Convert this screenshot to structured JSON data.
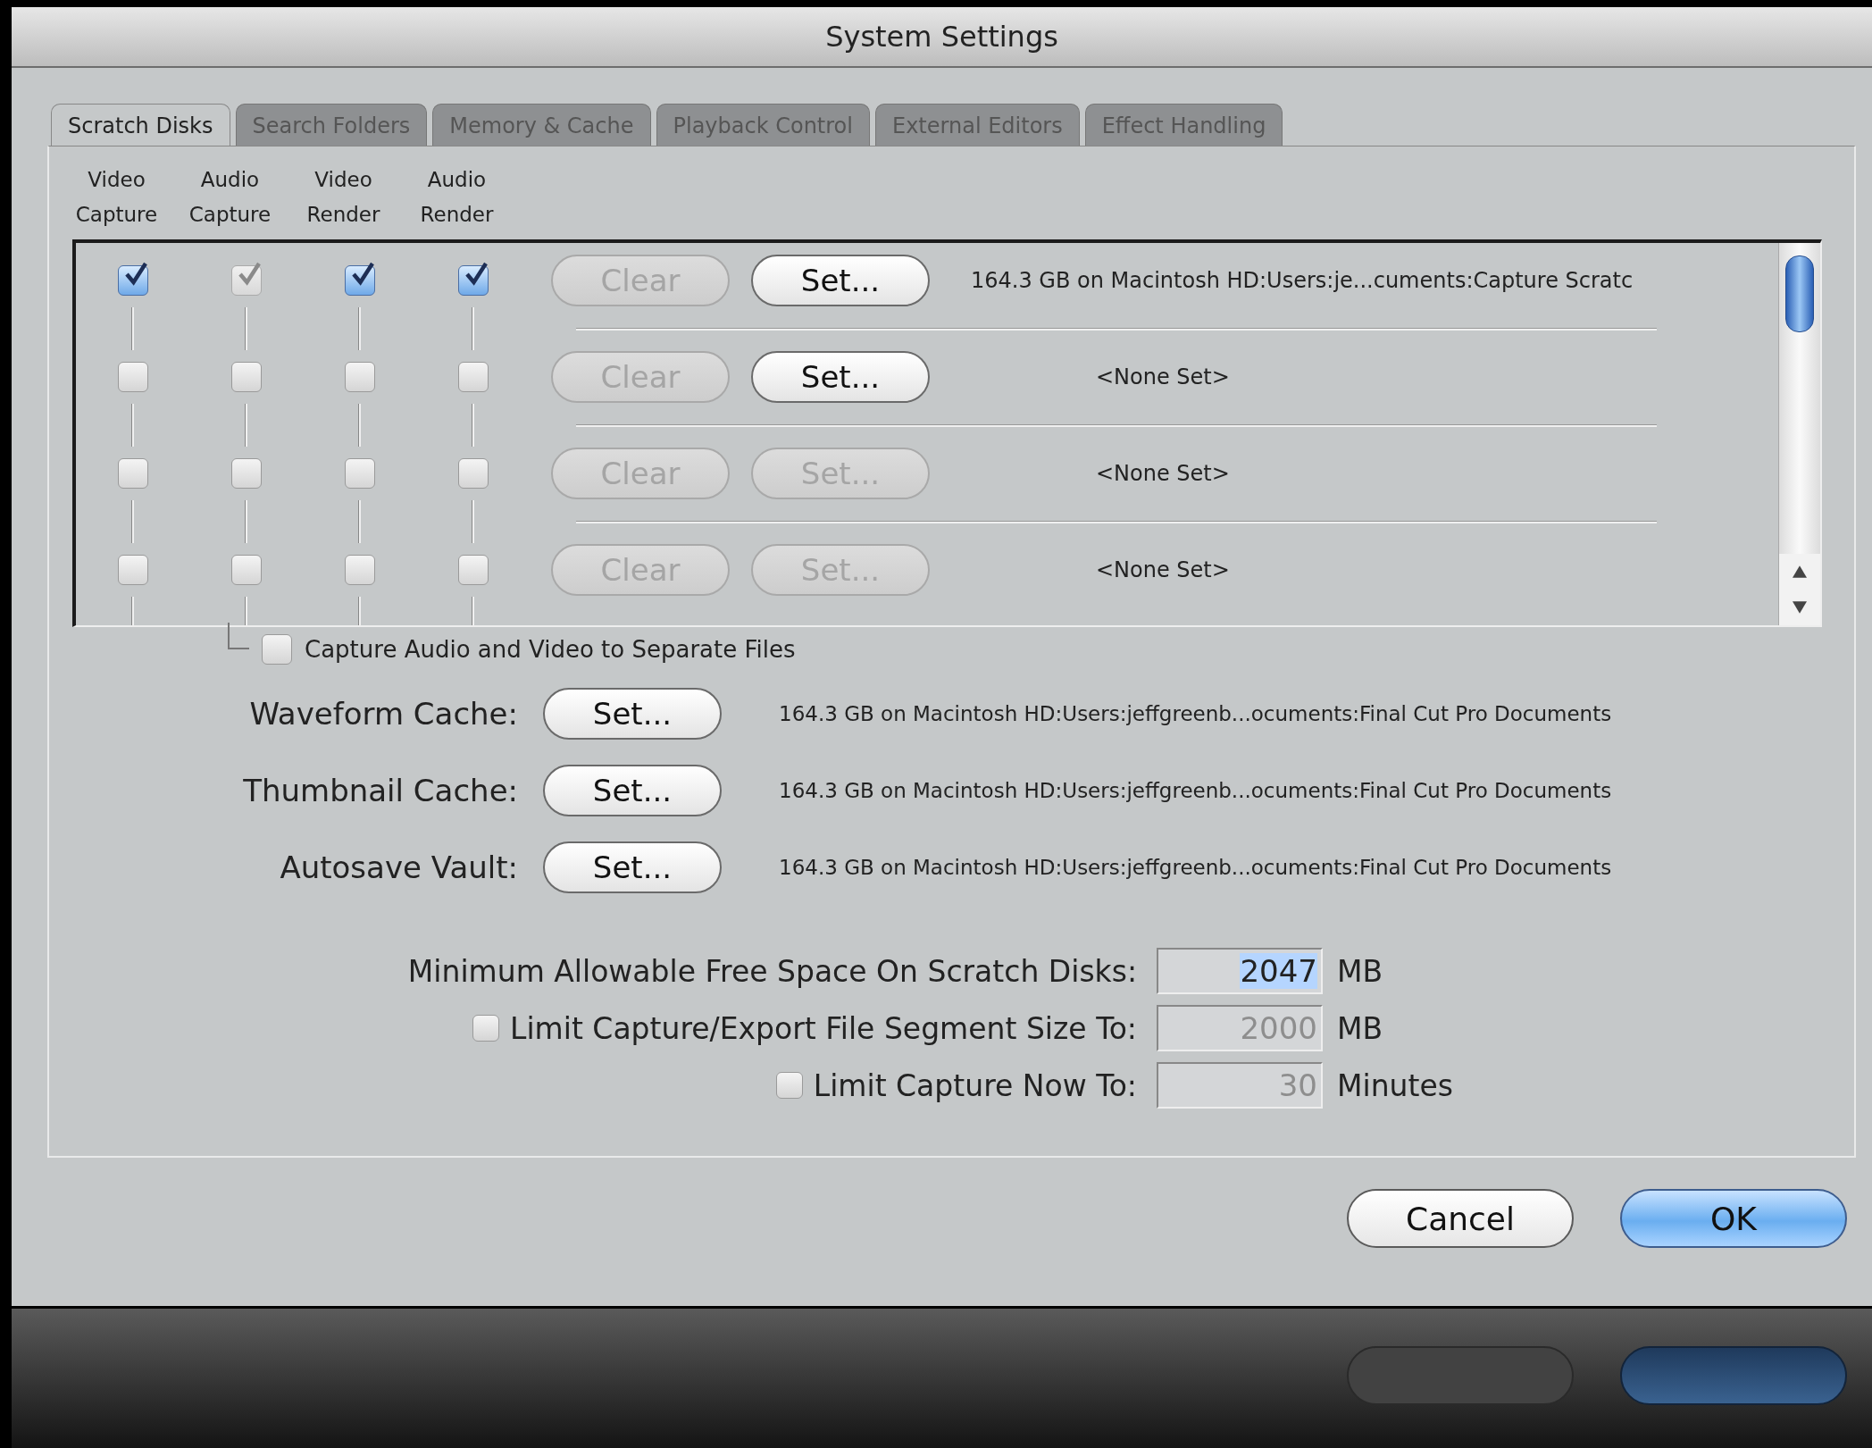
{
  "window": {
    "title": "System Settings"
  },
  "tabs": [
    {
      "label": "Scratch Disks",
      "selected": true
    },
    {
      "label": "Search Folders",
      "selected": false
    },
    {
      "label": "Memory & Cache",
      "selected": false
    },
    {
      "label": "Playback Control",
      "selected": false
    },
    {
      "label": "External Editors",
      "selected": false
    },
    {
      "label": "Effect Handling",
      "selected": false
    }
  ],
  "scratch_disks": {
    "column_headers": [
      {
        "line_1": "Video",
        "line_2": "Capture"
      },
      {
        "line_1": "Audio",
        "line_2": "Capture"
      },
      {
        "line_1": "Video",
        "line_2": "Render"
      },
      {
        "line_1": "Audio",
        "line_2": "Render"
      }
    ],
    "rows": [
      {
        "checks": [
          {
            "checked": true,
            "disabled": false
          },
          {
            "checked": true,
            "disabled": true
          },
          {
            "checked": true,
            "disabled": false
          },
          {
            "checked": true,
            "disabled": false
          }
        ],
        "clear": {
          "label": "Clear",
          "disabled": true
        },
        "set": {
          "label": "Set...",
          "disabled": false
        },
        "location": "164.3 GB on  Macintosh HD:Users:je...cuments:Capture Scratc"
      },
      {
        "checks": [
          {
            "checked": false,
            "disabled": false
          },
          {
            "checked": false,
            "disabled": false
          },
          {
            "checked": false,
            "disabled": false
          },
          {
            "checked": false,
            "disabled": false
          }
        ],
        "clear": {
          "label": "Clear",
          "disabled": true
        },
        "set": {
          "label": "Set...",
          "disabled": false
        },
        "location": "<None Set>"
      },
      {
        "checks": [
          {
            "checked": false,
            "disabled": false
          },
          {
            "checked": false,
            "disabled": false
          },
          {
            "checked": false,
            "disabled": false
          },
          {
            "checked": false,
            "disabled": false
          }
        ],
        "clear": {
          "label": "Clear",
          "disabled": true
        },
        "set": {
          "label": "Set...",
          "disabled": true
        },
        "location": "<None Set>"
      },
      {
        "checks": [
          {
            "checked": false,
            "disabled": false
          },
          {
            "checked": false,
            "disabled": false
          },
          {
            "checked": false,
            "disabled": false
          },
          {
            "checked": false,
            "disabled": false
          }
        ],
        "clear": {
          "label": "Clear",
          "disabled": true
        },
        "set": {
          "label": "Set...",
          "disabled": true
        },
        "location": "<None Set>"
      }
    ],
    "separate_files": {
      "label": "Capture Audio and Video to Separate Files",
      "checked": false
    }
  },
  "caches": [
    {
      "label": "Waveform Cache:",
      "button": "Set...",
      "location": "164.3 GB on  Macintosh HD:Users:jeffgreenb...ocuments:Final Cut Pro Documents"
    },
    {
      "label": "Thumbnail Cache:",
      "button": "Set...",
      "location": "164.3 GB on  Macintosh HD:Users:jeffgreenb...ocuments:Final Cut Pro Documents"
    },
    {
      "label": "Autosave Vault:",
      "button": "Set...",
      "location": "164.3 GB on  Macintosh HD:Users:jeffgreenb...ocuments:Final Cut Pro Documents"
    }
  ],
  "limits": [
    {
      "kind": "plain",
      "label": "Minimum Allowable Free Space On Scratch Disks:",
      "value": "2047",
      "disabled": false,
      "highlighted": true,
      "unit": "MB"
    },
    {
      "kind": "checkbox",
      "checked": false,
      "label": "Limit Capture/Export File Segment Size To:",
      "value": "2000",
      "disabled": true,
      "highlighted": false,
      "unit": "MB"
    },
    {
      "kind": "checkbox",
      "checked": false,
      "label": "Limit Capture Now To:",
      "value": "30",
      "disabled": true,
      "highlighted": false,
      "unit": "Minutes"
    }
  ],
  "buttons": [
    {
      "label": "Cancel",
      "default": false
    },
    {
      "label": "OK",
      "default": true
    }
  ],
  "reflection": {
    "buttons": [
      {
        "default": false
      },
      {
        "default": true
      }
    ]
  }
}
